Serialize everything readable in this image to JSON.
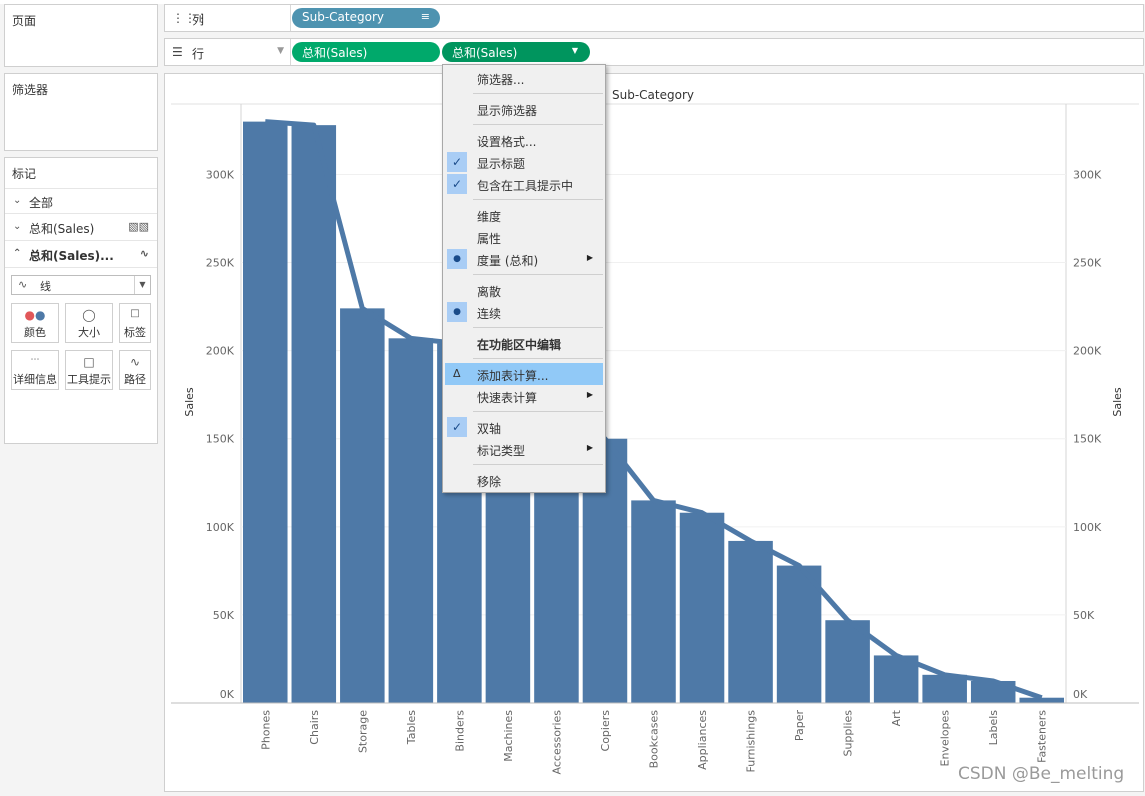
{
  "left_panel": {
    "pages_title": "页面",
    "filters_title": "筛选器",
    "marks_title": "标记",
    "marks_rows": [
      {
        "label": "全部",
        "icon": "chevron-down-icon"
      },
      {
        "label": "总和(Sales)",
        "icon": "bar-icon"
      },
      {
        "label": "总和(Sales)...",
        "icon": "line-icon"
      }
    ],
    "mark_type": "线",
    "mark_buttons": [
      {
        "label": "颜色",
        "icon": "color-icon"
      },
      {
        "label": "大小",
        "icon": "size-icon"
      },
      {
        "label": "标签",
        "icon": "label-icon"
      },
      {
        "label": "详细信息",
        "icon": "detail-icon"
      },
      {
        "label": "工具提示",
        "icon": "tooltip-icon"
      },
      {
        "label": "路径",
        "icon": "path-icon"
      }
    ]
  },
  "shelves": {
    "columns_label": "列",
    "columns_pill": "Sub-Category",
    "rows_label": "行",
    "rows_pill_1": "总和(Sales)",
    "rows_pill_2": "总和(Sales)"
  },
  "context_menu": {
    "items": [
      {
        "label": "筛选器...",
        "checked": false
      },
      {
        "label": "显示筛选器",
        "checked": false
      },
      {
        "label": "设置格式...",
        "checked": false
      },
      {
        "label": "显示标题",
        "checked": true
      },
      {
        "label": "包含在工具提示中",
        "checked": true
      },
      {
        "label": "维度",
        "checked": false
      },
      {
        "label": "属性",
        "checked": false
      },
      {
        "label": "度量 (总和)",
        "checked": "dot",
        "submenu": true
      },
      {
        "label": "离散",
        "checked": false
      },
      {
        "label": "连续",
        "checked": "dot"
      },
      {
        "label": "在功能区中编辑",
        "checked": false,
        "bold": true
      },
      {
        "label": "添加表计算...",
        "checked": "delta",
        "highlighted": true
      },
      {
        "label": "快速表计算",
        "checked": false,
        "submenu": true
      },
      {
        "label": "双轴",
        "checked": true
      },
      {
        "label": "标记类型",
        "checked": false,
        "submenu": true
      },
      {
        "label": "移除",
        "checked": false
      }
    ]
  },
  "chart_data": {
    "type": "bar",
    "title": "Sub-Category",
    "ylabel": "Sales",
    "ylabel_right": "Sales",
    "ylim": [
      0,
      340000
    ],
    "y_ticks": [
      "0K",
      "50K",
      "100K",
      "150K",
      "200K",
      "250K",
      "300K"
    ],
    "categories": [
      "Phones",
      "Chairs",
      "Storage",
      "Tables",
      "Binders",
      "Machines",
      "Accessories",
      "Copiers",
      "Bookcases",
      "Appliances",
      "Furnishings",
      "Paper",
      "Supplies",
      "Art",
      "Envelopes",
      "Labels",
      "Fasteners"
    ],
    "series": [
      {
        "type": "bar",
        "values": [
          330000,
          328000,
          224000,
          207000,
          204000,
          189000,
          167000,
          150000,
          115000,
          108000,
          92000,
          78000,
          47000,
          27000,
          16000,
          12500,
          3000
        ]
      },
      {
        "type": "line",
        "values": [
          330000,
          328000,
          224000,
          207000,
          204000,
          189000,
          167000,
          150000,
          115000,
          108000,
          92000,
          78000,
          47000,
          27000,
          16000,
          12500,
          3000
        ]
      }
    ],
    "bar_color": "#4e79a7"
  },
  "watermark": "CSDN @Be_melting"
}
